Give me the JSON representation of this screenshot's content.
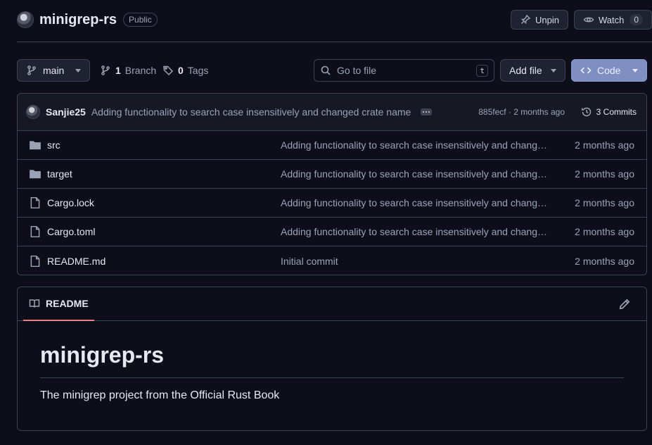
{
  "repo": {
    "name": "minigrep-rs",
    "visibility": "Public",
    "actions": {
      "unpin_label": "Unpin",
      "watch_label": "Watch",
      "watch_count": "0"
    }
  },
  "toolbar": {
    "branch": "main",
    "branches_count": "1",
    "branches_label": "Branch",
    "tags_count": "0",
    "tags_label": "Tags",
    "search_placeholder": "Go to file",
    "search_shortcut": "t",
    "add_file_label": "Add file",
    "code_label": "Code"
  },
  "latest_commit": {
    "author": "Sanjie25",
    "message": "Adding functionality to search case insensitively and changed crate name",
    "meta": "885fecf · 2 months ago",
    "commits_label": "3 Commits"
  },
  "files": [
    {
      "name": "src",
      "type": "folder",
      "message": "Adding functionality to search case insensitively and changed crate name",
      "date": "2 months ago"
    },
    {
      "name": "target",
      "type": "folder",
      "message": "Adding functionality to search case insensitively and changed crate name",
      "date": "2 months ago"
    },
    {
      "name": "Cargo.lock",
      "type": "file",
      "message": "Adding functionality to search case insensitively and changed crate name",
      "date": "2 months ago"
    },
    {
      "name": "Cargo.toml",
      "type": "file",
      "message": "Adding functionality to search case insensitively and changed crate name",
      "date": "2 months ago"
    },
    {
      "name": "README.md",
      "type": "file",
      "message": "Initial commit",
      "date": "2 months ago"
    }
  ],
  "readme": {
    "tab_label": "README",
    "title": "minigrep-rs",
    "description": "The minigrep project from the Official Rust Book"
  },
  "colors": {
    "background": "#0e0e1a",
    "border": "#3d4354",
    "code_button": "#7f8fc2",
    "readme_tab_underline": "#f08080"
  }
}
